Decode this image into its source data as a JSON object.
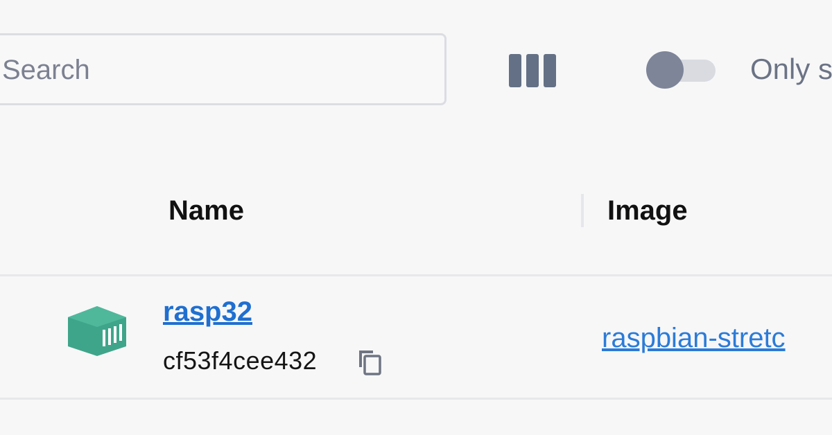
{
  "search": {
    "placeholder": "Search",
    "value": ""
  },
  "toolbar": {
    "columns_icon": "columns-icon",
    "toggle_label": "Only s",
    "toggle_on": false
  },
  "table": {
    "columns": [
      {
        "label": "Name"
      },
      {
        "label": "Image"
      }
    ],
    "rows": [
      {
        "icon": "container-icon",
        "name": "rasp32",
        "id": "cf53f4cee432",
        "copy_icon": "copy-icon",
        "image": "raspbian-stretc"
      }
    ]
  },
  "colors": {
    "link": "#1f6fd0",
    "container_icon": "#3fa58a",
    "toggle_knob": "#7e8599",
    "toggle_track": "#d9dbe1"
  }
}
